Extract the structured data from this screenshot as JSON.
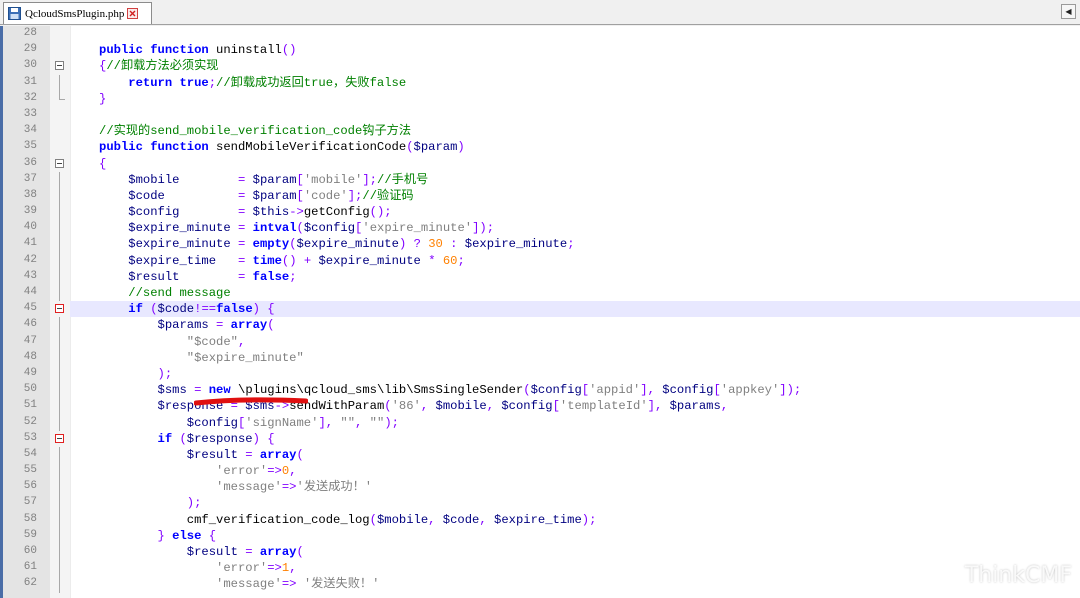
{
  "tab": {
    "label": "QcloudSmsPlugin.php"
  },
  "watermark": "ThinkCMF",
  "lines": [
    {
      "n": "28",
      "fold": "",
      "tokens": []
    },
    {
      "n": "29",
      "fold": "",
      "tokens": [
        [
          "kw",
          "public function "
        ],
        [
          "fn",
          "uninstall"
        ],
        [
          "op",
          "()"
        ]
      ]
    },
    {
      "n": "30",
      "fold": "box",
      "tokens": [
        [
          "op",
          "{"
        ],
        [
          "cm",
          "//卸载方法必须实现"
        ]
      ]
    },
    {
      "n": "31",
      "fold": "",
      "tokens": [
        [
          "fn",
          "    "
        ],
        [
          "kw",
          "return true"
        ],
        [
          "op",
          ";"
        ],
        [
          "cm",
          "//卸载成功返回true，失败false"
        ]
      ]
    },
    {
      "n": "32",
      "fold": "end",
      "tokens": [
        [
          "op",
          "}"
        ]
      ]
    },
    {
      "n": "33",
      "fold": "",
      "tokens": []
    },
    {
      "n": "34",
      "fold": "",
      "tokens": [
        [
          "cm",
          "//实现的send_mobile_verification_code钩子方法"
        ]
      ]
    },
    {
      "n": "35",
      "fold": "",
      "tokens": [
        [
          "kw",
          "public function "
        ],
        [
          "fn",
          "sendMobileVerificationCode"
        ],
        [
          "op",
          "("
        ],
        [
          "var",
          "$param"
        ],
        [
          "op",
          ")"
        ]
      ]
    },
    {
      "n": "36",
      "fold": "box",
      "tokens": [
        [
          "op",
          "{"
        ]
      ]
    },
    {
      "n": "37",
      "fold": "",
      "tokens": [
        [
          "fn",
          "    "
        ],
        [
          "var",
          "$mobile        "
        ],
        [
          "op",
          "= "
        ],
        [
          "var",
          "$param"
        ],
        [
          "op",
          "["
        ],
        [
          "str",
          "'mobile'"
        ],
        [
          "op",
          "];"
        ],
        [
          "cm",
          "//手机号"
        ]
      ]
    },
    {
      "n": "38",
      "fold": "",
      "tokens": [
        [
          "fn",
          "    "
        ],
        [
          "var",
          "$code          "
        ],
        [
          "op",
          "= "
        ],
        [
          "var",
          "$param"
        ],
        [
          "op",
          "["
        ],
        [
          "str",
          "'code'"
        ],
        [
          "op",
          "];"
        ],
        [
          "cm",
          "//验证码"
        ]
      ]
    },
    {
      "n": "39",
      "fold": "",
      "tokens": [
        [
          "fn",
          "    "
        ],
        [
          "var",
          "$config        "
        ],
        [
          "op",
          "= "
        ],
        [
          "var",
          "$this"
        ],
        [
          "op",
          "->"
        ],
        [
          "fn",
          "getConfig"
        ],
        [
          "op",
          "();"
        ]
      ]
    },
    {
      "n": "40",
      "fold": "",
      "tokens": [
        [
          "fn",
          "    "
        ],
        [
          "var",
          "$expire_minute "
        ],
        [
          "op",
          "= "
        ],
        [
          "kw",
          "intval"
        ],
        [
          "op",
          "("
        ],
        [
          "var",
          "$config"
        ],
        [
          "op",
          "["
        ],
        [
          "str",
          "'expire_minute'"
        ],
        [
          "op",
          "]);"
        ]
      ]
    },
    {
      "n": "41",
      "fold": "",
      "tokens": [
        [
          "fn",
          "    "
        ],
        [
          "var",
          "$expire_minute "
        ],
        [
          "op",
          "= "
        ],
        [
          "kw",
          "empty"
        ],
        [
          "op",
          "("
        ],
        [
          "var",
          "$expire_minute"
        ],
        [
          "op",
          ") ? "
        ],
        [
          "num",
          "30"
        ],
        [
          "op",
          " : "
        ],
        [
          "var",
          "$expire_minute"
        ],
        [
          "op",
          ";"
        ]
      ]
    },
    {
      "n": "42",
      "fold": "",
      "tokens": [
        [
          "fn",
          "    "
        ],
        [
          "var",
          "$expire_time   "
        ],
        [
          "op",
          "= "
        ],
        [
          "kw",
          "time"
        ],
        [
          "op",
          "() + "
        ],
        [
          "var",
          "$expire_minute"
        ],
        [
          "op",
          " * "
        ],
        [
          "num",
          "60"
        ],
        [
          "op",
          ";"
        ]
      ]
    },
    {
      "n": "43",
      "fold": "",
      "tokens": [
        [
          "fn",
          "    "
        ],
        [
          "var",
          "$result        "
        ],
        [
          "op",
          "= "
        ],
        [
          "kw",
          "false"
        ],
        [
          "op",
          ";"
        ]
      ]
    },
    {
      "n": "44",
      "fold": "",
      "tokens": [
        [
          "fn",
          "    "
        ],
        [
          "cm",
          "//send message"
        ]
      ]
    },
    {
      "n": "45",
      "fold": "redbox",
      "hl": true,
      "tokens": [
        [
          "fn",
          "    "
        ],
        [
          "kw",
          "if "
        ],
        [
          "op",
          "("
        ],
        [
          "var",
          "$code"
        ],
        [
          "op",
          "!=="
        ],
        [
          "kw",
          "false"
        ],
        [
          "op",
          ") "
        ],
        [
          "op",
          "{"
        ]
      ]
    },
    {
      "n": "46",
      "fold": "",
      "tokens": [
        [
          "fn",
          "        "
        ],
        [
          "var",
          "$params "
        ],
        [
          "op",
          "= "
        ],
        [
          "kw",
          "array"
        ],
        [
          "op",
          "("
        ]
      ]
    },
    {
      "n": "47",
      "fold": "",
      "tokens": [
        [
          "fn",
          "            "
        ],
        [
          "str",
          "\"$code\""
        ],
        [
          "op",
          ","
        ]
      ]
    },
    {
      "n": "48",
      "fold": "",
      "tokens": [
        [
          "fn",
          "            "
        ],
        [
          "str",
          "\"$expire_minute\""
        ]
      ]
    },
    {
      "n": "49",
      "fold": "",
      "tokens": [
        [
          "fn",
          "        "
        ],
        [
          "op",
          ");"
        ]
      ]
    },
    {
      "n": "50",
      "fold": "",
      "tokens": [
        [
          "fn",
          "        "
        ],
        [
          "var",
          "$sms "
        ],
        [
          "op",
          "= "
        ],
        [
          "kw",
          "new "
        ],
        [
          "fn",
          "\\plugins\\qcloud_sms\\lib\\SmsSingleSender"
        ],
        [
          "op",
          "("
        ],
        [
          "var",
          "$config"
        ],
        [
          "op",
          "["
        ],
        [
          "str",
          "'appid'"
        ],
        [
          "op",
          "], "
        ],
        [
          "var",
          "$config"
        ],
        [
          "op",
          "["
        ],
        [
          "str",
          "'appkey'"
        ],
        [
          "op",
          "]);"
        ]
      ]
    },
    {
      "n": "51",
      "fold": "",
      "tokens": [
        [
          "fn",
          "        "
        ],
        [
          "var",
          "$response "
        ],
        [
          "op",
          "= "
        ],
        [
          "var",
          "$sms"
        ],
        [
          "op",
          "->"
        ],
        [
          "fn",
          "sendWithParam"
        ],
        [
          "op",
          "("
        ],
        [
          "str",
          "'86'"
        ],
        [
          "op",
          ", "
        ],
        [
          "var",
          "$mobile"
        ],
        [
          "op",
          ", "
        ],
        [
          "var",
          "$config"
        ],
        [
          "op",
          "["
        ],
        [
          "str",
          "'templateId'"
        ],
        [
          "op",
          "], "
        ],
        [
          "var",
          "$params"
        ],
        [
          "op",
          ","
        ]
      ]
    },
    {
      "n": "52",
      "fold": "",
      "tokens": [
        [
          "fn",
          "            "
        ],
        [
          "var",
          "$config"
        ],
        [
          "op",
          "["
        ],
        [
          "str",
          "'signName'"
        ],
        [
          "op",
          "], "
        ],
        [
          "str",
          "\"\""
        ],
        [
          "op",
          ", "
        ],
        [
          "str",
          "\"\""
        ],
        [
          "op",
          ");"
        ]
      ]
    },
    {
      "n": "53",
      "fold": "redbox",
      "tokens": [
        [
          "fn",
          "        "
        ],
        [
          "kw",
          "if "
        ],
        [
          "op",
          "("
        ],
        [
          "var",
          "$response"
        ],
        [
          "op",
          ") {"
        ]
      ]
    },
    {
      "n": "54",
      "fold": "",
      "tokens": [
        [
          "fn",
          "            "
        ],
        [
          "var",
          "$result "
        ],
        [
          "op",
          "= "
        ],
        [
          "kw",
          "array"
        ],
        [
          "op",
          "("
        ]
      ]
    },
    {
      "n": "55",
      "fold": "",
      "tokens": [
        [
          "fn",
          "                "
        ],
        [
          "str",
          "'error'"
        ],
        [
          "op",
          "=>"
        ],
        [
          "num",
          "0"
        ],
        [
          "op",
          ","
        ]
      ]
    },
    {
      "n": "56",
      "fold": "",
      "tokens": [
        [
          "fn",
          "                "
        ],
        [
          "str",
          "'message'"
        ],
        [
          "op",
          "=>"
        ],
        [
          "str",
          "'发送成功！'"
        ]
      ]
    },
    {
      "n": "57",
      "fold": "",
      "tokens": [
        [
          "fn",
          "            "
        ],
        [
          "op",
          ");"
        ]
      ]
    },
    {
      "n": "58",
      "fold": "",
      "tokens": [
        [
          "fn",
          "            "
        ],
        [
          "fn",
          "cmf_verification_code_log"
        ],
        [
          "op",
          "("
        ],
        [
          "var",
          "$mobile"
        ],
        [
          "op",
          ", "
        ],
        [
          "var",
          "$code"
        ],
        [
          "op",
          ", "
        ],
        [
          "var",
          "$expire_time"
        ],
        [
          "op",
          ");"
        ]
      ]
    },
    {
      "n": "59",
      "fold": "",
      "tokens": [
        [
          "fn",
          "        "
        ],
        [
          "op",
          "} "
        ],
        [
          "kw",
          "else "
        ],
        [
          "op",
          "{"
        ]
      ]
    },
    {
      "n": "60",
      "fold": "",
      "tokens": [
        [
          "fn",
          "            "
        ],
        [
          "var",
          "$result "
        ],
        [
          "op",
          "= "
        ],
        [
          "kw",
          "array"
        ],
        [
          "op",
          "("
        ]
      ]
    },
    {
      "n": "61",
      "fold": "",
      "tokens": [
        [
          "fn",
          "                "
        ],
        [
          "str",
          "'error'"
        ],
        [
          "op",
          "=>"
        ],
        [
          "num",
          "1"
        ],
        [
          "op",
          ","
        ]
      ]
    },
    {
      "n": "62",
      "fold": "",
      "tokens": [
        [
          "fn",
          "                "
        ],
        [
          "str",
          "'message'"
        ],
        [
          "op",
          "=> "
        ],
        [
          "str",
          "'发送失败！'"
        ]
      ]
    }
  ]
}
